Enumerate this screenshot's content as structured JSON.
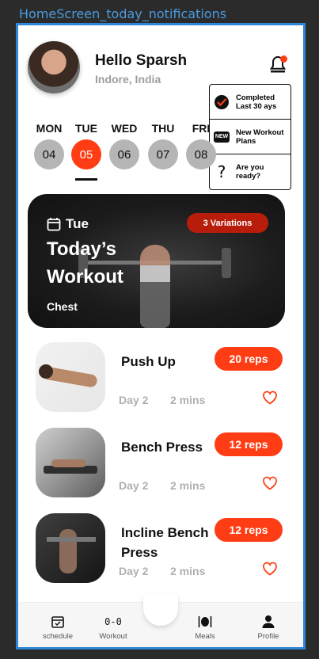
{
  "frame_label": "HomeScreen_today_notifications",
  "colors": {
    "accent": "#ff3d14",
    "badge": "#b81c0b",
    "hero_bg": "#1c1c1c"
  },
  "header": {
    "greeting": "Hello Sparsh",
    "location": "Indore, India"
  },
  "notifications": [
    {
      "icon": "check-circle-icon",
      "text": "Completed Last 30 ays"
    },
    {
      "icon": "new-badge-icon",
      "icon_text": "NEW",
      "text": "New Workout Plans"
    },
    {
      "icon": "question-mark-icon",
      "icon_text": "?",
      "text": "Are you ready?"
    }
  ],
  "days": [
    {
      "label": "MON",
      "num": "04"
    },
    {
      "label": "TUE",
      "num": "05",
      "active": true
    },
    {
      "label": "WED",
      "num": "06"
    },
    {
      "label": "THU",
      "num": "07"
    },
    {
      "label": "FRI",
      "num": "08"
    }
  ],
  "hero": {
    "day": "Tue",
    "title": "Today’s Workout",
    "muscle": "Chest",
    "variations": "3 Variations"
  },
  "exercises": [
    {
      "name": "Push Up",
      "reps": "20 reps",
      "day": "Day 2",
      "duration": "2 mins"
    },
    {
      "name": "Bench Press",
      "reps": "12 reps",
      "day": "Day 2",
      "duration": "2 mins"
    },
    {
      "name": "Incline Bench Press",
      "reps": "12 reps",
      "day": "Day 2",
      "duration": "2 mins"
    }
  ],
  "nav": [
    {
      "label": "schedule",
      "icon": "calendar-check-icon"
    },
    {
      "label": "Workout",
      "icon": "dumbbell-icon",
      "icon_text": "0-0"
    },
    {
      "label": "Meals",
      "icon": "fork-knife-icon"
    },
    {
      "label": "Profile",
      "icon": "user-icon"
    }
  ]
}
